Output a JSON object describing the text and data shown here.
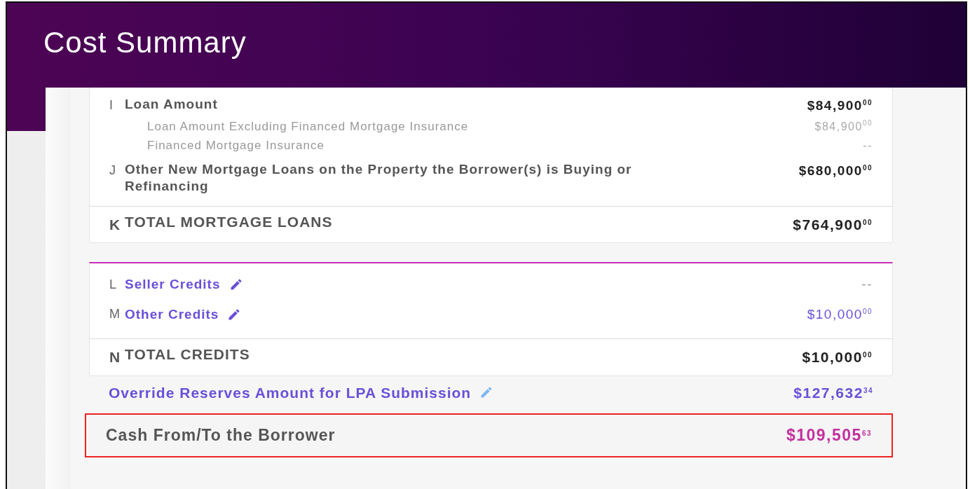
{
  "header": {
    "title": "Cost Summary"
  },
  "loans": {
    "items": [
      {
        "letter": "I",
        "label": "Loan Amount",
        "amount": "$84,900$^{00}$",
        "children": [
          {
            "label": "Loan Amount Excluding Financed Mortgage Insurance",
            "amount": "$84,900$^{00}$"
          },
          {
            "label": "Financed Mortgage Insurance",
            "amount": "--"
          }
        ]
      },
      {
        "letter": "J",
        "label": "Other New Mortgage Loans on the Property the Borrower(s) is Buying or Refinancing",
        "amount": "$680,000$^{00}$"
      }
    ],
    "total": {
      "letter": "K",
      "label": "TOTAL MORTGAGE LOANS",
      "amount": "$764,900$^{00}$"
    }
  },
  "credits": {
    "items": [
      {
        "letter": "L",
        "label": "Seller Credits",
        "amount": "--",
        "editable": true
      },
      {
        "letter": "M",
        "label": "Other Credits",
        "amount": "$10,000$^{00}$",
        "editable": true
      }
    ],
    "total": {
      "letter": "N",
      "label": "TOTAL CREDITS",
      "amount": "$10,000$^{00}$"
    }
  },
  "override": {
    "label": "Override Reserves Amount for LPA Submission",
    "amount": "$127,632$^{34}$",
    "editable": true
  },
  "cash": {
    "label": "Cash From/To the Borrower",
    "amount": "$109,505$^{63}$",
    "highlighted": true
  }
}
